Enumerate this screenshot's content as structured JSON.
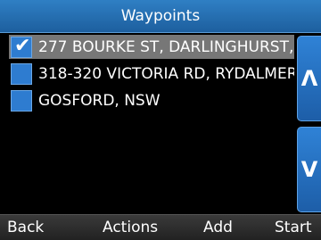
{
  "title": "Waypoints",
  "waypoints": [
    {
      "label": "277 BOURKE ST, DARLINGHURST,",
      "checked": true,
      "selected": true
    },
    {
      "label": "318-320 VICTORIA RD, RYDALMER",
      "checked": false,
      "selected": false
    },
    {
      "label": "GOSFORD, NSW",
      "checked": false,
      "selected": false
    }
  ],
  "scroll": {
    "up_label": "Λ",
    "down_label": "V"
  },
  "bottom": {
    "back": "Back",
    "actions": "Actions",
    "add": "Add",
    "start": "Start"
  },
  "icons": {
    "check": "✔"
  },
  "colors": {
    "title_bar": "#1d5f9e",
    "checkbox": "#2e7cd0",
    "selected_row": "#777777"
  }
}
